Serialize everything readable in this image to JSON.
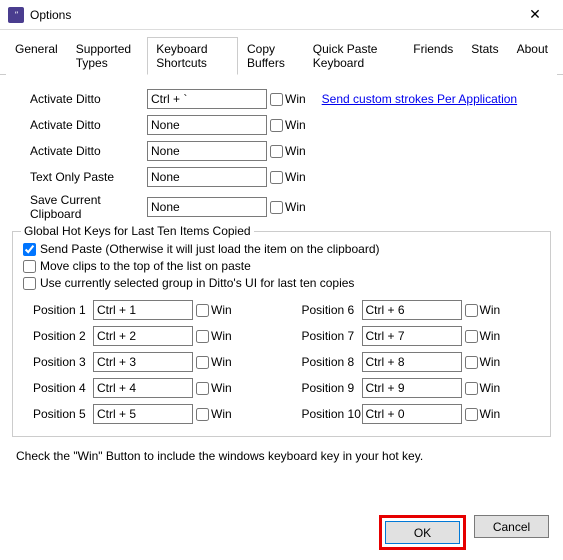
{
  "window": {
    "title": "Options"
  },
  "tabs": {
    "general": "General",
    "supported": "Supported Types",
    "keyboard": "Keyboard Shortcuts",
    "copybuf": "Copy Buffers",
    "quickpaste": "Quick Paste Keyboard",
    "friends": "Friends",
    "stats": "Stats",
    "about": "About"
  },
  "shortcuts": {
    "activate1": {
      "label": "Activate Ditto",
      "value": "Ctrl + `",
      "win": "Win"
    },
    "activate2": {
      "label": "Activate Ditto",
      "value": "None",
      "win": "Win"
    },
    "activate3": {
      "label": "Activate Ditto",
      "value": "None",
      "win": "Win"
    },
    "textonly": {
      "label": "Text Only Paste",
      "value": "None",
      "win": "Win"
    },
    "savecur": {
      "label": "Save Current Clipboard",
      "value": "None",
      "win": "Win"
    },
    "link": "Send custom strokes Per Application"
  },
  "group": {
    "legend": "Global Hot Keys for Last Ten Items Copied",
    "sendpaste": "Send Paste (Otherwise it will just load the item on the clipboard)",
    "moveclips": "Move clips to the top of the list on paste",
    "usegroup": "Use currently selected group in Ditto's UI for last ten copies"
  },
  "positions": {
    "p1": {
      "label": "Position 1",
      "value": "Ctrl + 1",
      "win": "Win"
    },
    "p2": {
      "label": "Position 2",
      "value": "Ctrl + 2",
      "win": "Win"
    },
    "p3": {
      "label": "Position 3",
      "value": "Ctrl + 3",
      "win": "Win"
    },
    "p4": {
      "label": "Position 4",
      "value": "Ctrl + 4",
      "win": "Win"
    },
    "p5": {
      "label": "Position 5",
      "value": "Ctrl + 5",
      "win": "Win"
    },
    "p6": {
      "label": "Position 6",
      "value": "Ctrl + 6",
      "win": "Win"
    },
    "p7": {
      "label": "Position 7",
      "value": "Ctrl + 7",
      "win": "Win"
    },
    "p8": {
      "label": "Position 8",
      "value": "Ctrl + 8",
      "win": "Win"
    },
    "p9": {
      "label": "Position 9",
      "value": "Ctrl + 9",
      "win": "Win"
    },
    "p10": {
      "label": "Position 10",
      "value": "Ctrl + 0",
      "win": "Win"
    }
  },
  "footnote": "Check the \"Win\" Button to include the windows keyboard key in your hot key.",
  "buttons": {
    "ok": "OK",
    "cancel": "Cancel"
  }
}
